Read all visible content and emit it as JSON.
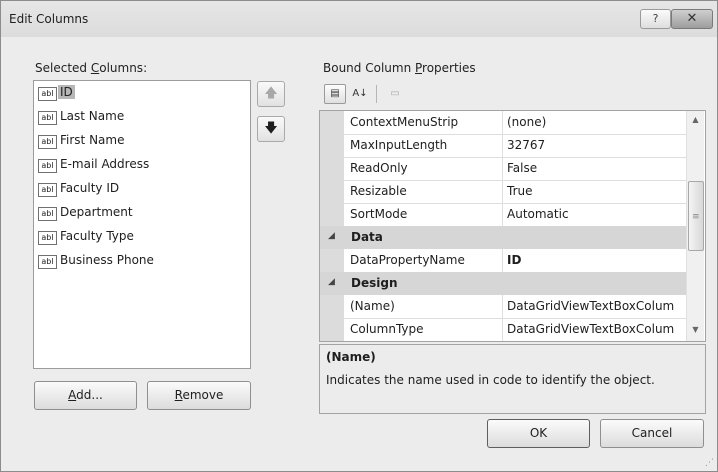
{
  "window": {
    "title": "Edit Columns",
    "help_label": "?",
    "close_label": "✕"
  },
  "selected_columns": {
    "label_prefix": "Selected ",
    "label_accel": "C",
    "label_suffix": "olumns:",
    "icon_text": "abl",
    "items": [
      {
        "label": "ID",
        "selected": true
      },
      {
        "label": "Last Name"
      },
      {
        "label": "First Name"
      },
      {
        "label": "E-mail Address"
      },
      {
        "label": "Faculty ID"
      },
      {
        "label": "Department"
      },
      {
        "label": "Faculty Type"
      },
      {
        "label": "Business Phone"
      }
    ]
  },
  "move_buttons": {
    "up_label": "🡅",
    "down_label": "🡇"
  },
  "buttons": {
    "add_accel": "A",
    "add_rest": "dd...",
    "remove_accel": "R",
    "remove_rest": "emove",
    "ok_label": "OK",
    "cancel_label": "Cancel"
  },
  "properties": {
    "label_prefix": "Bound Column ",
    "label_accel": "P",
    "label_suffix": "roperties",
    "toolbar": {
      "categorized_icon": "▤",
      "alphabetical_icon": "A↓",
      "pages_icon": "▭"
    },
    "rows": [
      {
        "name": "ContextMenuStrip",
        "value": "(none)"
      },
      {
        "name": "MaxInputLength",
        "value": "32767"
      },
      {
        "name": "ReadOnly",
        "value": "False"
      },
      {
        "name": "Resizable",
        "value": "True"
      },
      {
        "name": "SortMode",
        "value": "Automatic"
      }
    ],
    "category_data": {
      "expander": "◢",
      "title": "Data"
    },
    "data_rows": [
      {
        "name": "DataPropertyName",
        "value": "ID"
      }
    ],
    "category_design": {
      "expander": "◢",
      "title": "Design"
    },
    "design_rows": [
      {
        "name": "(Name)",
        "value": "DataGridViewTextBoxColum"
      },
      {
        "name": "ColumnType",
        "value": "DataGridViewTextBoxColum"
      }
    ],
    "scroll": {
      "up": "▲",
      "down": "▼",
      "grip": "≡"
    }
  },
  "description": {
    "title": "(Name)",
    "text": "Indicates the name used in code to identify the object."
  }
}
